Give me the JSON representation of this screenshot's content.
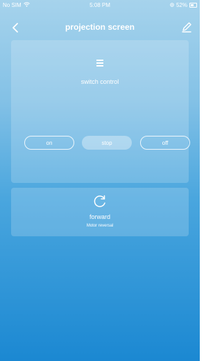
{
  "status_bar": {
    "carrier": "No SIM",
    "time": "5:08 PM",
    "battery_text": "52%",
    "battery_level": 0.52
  },
  "nav": {
    "title": "projection screen",
    "icons": [
      "chevron-left-icon",
      "edit-pencil-icon"
    ]
  },
  "switch_card": {
    "icon": "menu-icon",
    "label": "switch control",
    "buttons": [
      {
        "label": "on",
        "selected": false
      },
      {
        "label": "stop",
        "selected": true
      },
      {
        "label": "off",
        "selected": false
      }
    ]
  },
  "motor_card": {
    "icon": "reverse-arrow-icon",
    "title": "forward",
    "subtitle": "Motor reversal"
  }
}
